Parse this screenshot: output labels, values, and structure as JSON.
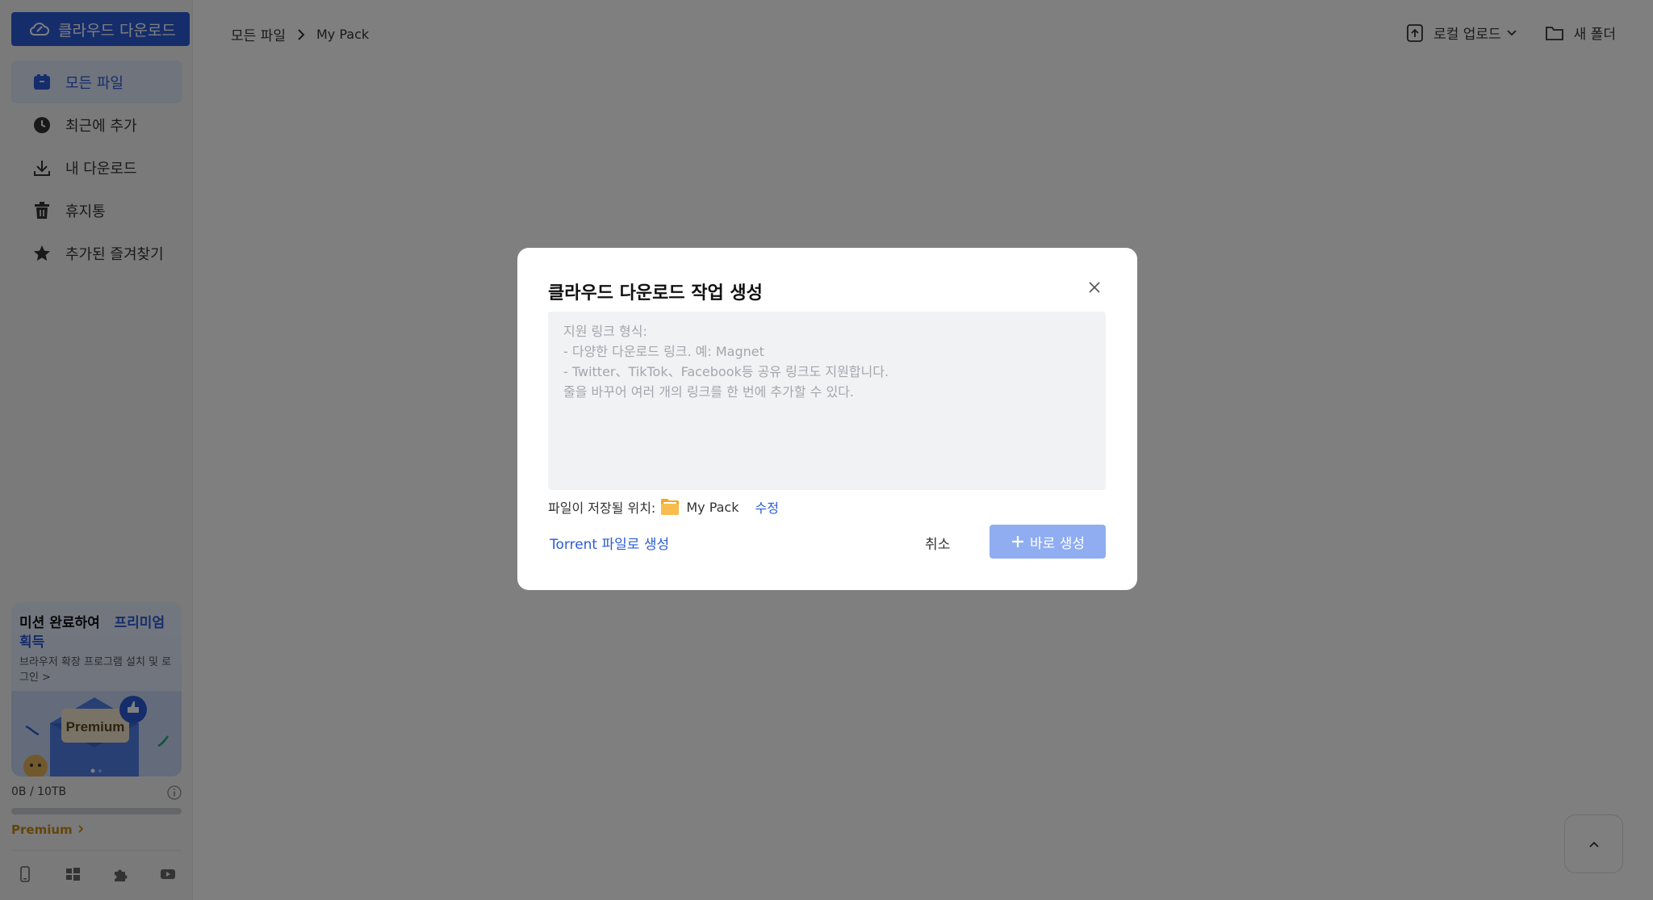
{
  "sidebar": {
    "brand_label": "클라우드 다운로드",
    "items": [
      {
        "label": "모든 파일",
        "icon": "files-icon",
        "active": true
      },
      {
        "label": "최근에 추가",
        "icon": "clock-icon"
      },
      {
        "label": "내 다운로드",
        "icon": "download-icon"
      },
      {
        "label": "휴지통",
        "icon": "trash-icon"
      },
      {
        "label": "추가된 즐겨찾기",
        "icon": "star-icon"
      }
    ],
    "promo": {
      "title": "미션 완료하여",
      "title_highlight": "프리미엄 획득",
      "subtitle": "브라우저 확장 프로그램 설치 및 로그인 >",
      "art_label": "Premium"
    },
    "storage": "0B / 10TB",
    "storage_used_fraction": 0,
    "premium_link": "Premium",
    "bottom_icons": [
      "phone-icon",
      "windows-icon",
      "extension-icon",
      "youtube-icon"
    ]
  },
  "header": {
    "breadcrumb_root": "모든 파일",
    "breadcrumb_current": "My Pack",
    "upload_label": "로컬 업로드",
    "new_folder_label": "새 폴더"
  },
  "modal": {
    "title": "클라우드 다운로드 작업 생성",
    "placeholder": "지원 링크 형식:\n- 다양한 다운로드 링크. 예: Magnet\n- Twitter、TikTok、Facebook등 공유 링크도 지원합니다.\n줄을 바꾸어 여러 개의 링크를 한 번에 추가할 수 있다.",
    "save_location_label": "파일이 저장될 위치:",
    "save_location_folder": "My Pack",
    "edit_label": "수정",
    "torrent_label": "Torrent 파일로 생성",
    "cancel_label": "취소",
    "create_label": "바로 생성"
  },
  "colors": {
    "accent": "#2a5bd7",
    "create_button_disabled": "#8fadf0",
    "premium": "#c98a12",
    "folder": "#f5a623"
  }
}
